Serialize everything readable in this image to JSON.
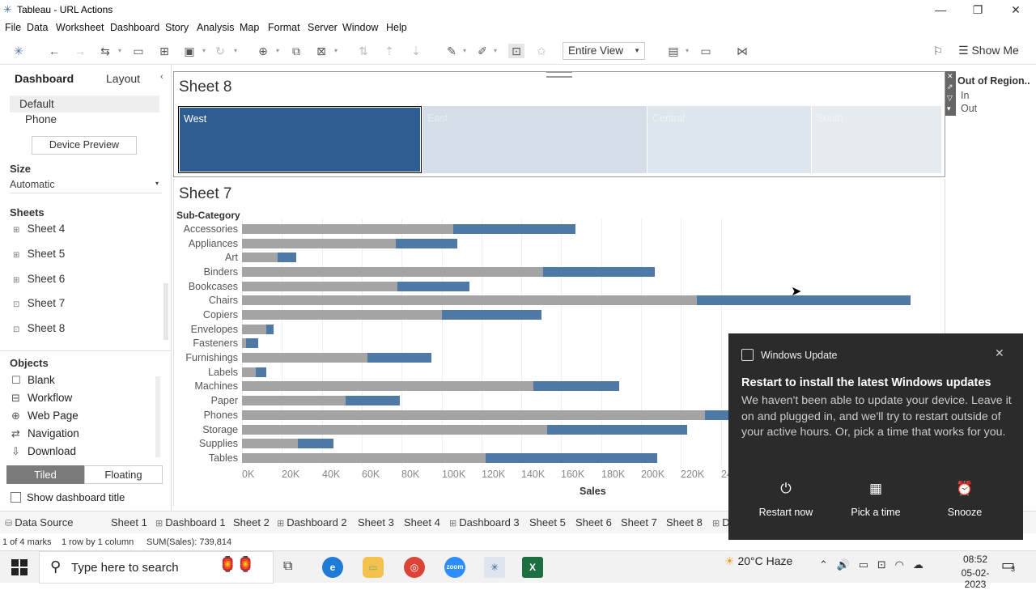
{
  "window": {
    "title": "Tableau - URL Actions",
    "minimize": "—",
    "restore": "❐",
    "close": "✕"
  },
  "menu": [
    "File",
    "Data",
    "Worksheet",
    "Dashboard",
    "Story",
    "Analysis",
    "Map",
    "Format",
    "Server",
    "Window",
    "Help"
  ],
  "toolbar": {
    "view_select": "Entire View",
    "show_me": "Show Me"
  },
  "sidebar": {
    "tabs": {
      "dashboard": "Dashboard",
      "layout": "Layout"
    },
    "device": {
      "default": "Default",
      "phone": "Phone",
      "preview_button": "Device Preview"
    },
    "size": {
      "heading": "Size",
      "value": "Automatic"
    },
    "sheets_heading": "Sheets",
    "sheets": [
      "Sheet 4",
      "Sheet 5",
      "Sheet 6",
      "Sheet 7",
      "Sheet 8"
    ],
    "objects_heading": "Objects",
    "objects": [
      {
        "label": "Blank",
        "icon": "blank-icon"
      },
      {
        "label": "Workflow",
        "icon": "workflow-icon"
      },
      {
        "label": "Web Page",
        "icon": "globe-icon"
      },
      {
        "label": "Navigation",
        "icon": "navigation-icon"
      },
      {
        "label": "Download",
        "icon": "download-icon"
      }
    ],
    "tiled": "Tiled",
    "floating": "Floating",
    "show_title": "Show dashboard title"
  },
  "sheet8": {
    "title": "Sheet 8",
    "regions": [
      {
        "name": "West",
        "color": "#2e5d93",
        "selected": true
      },
      {
        "name": "East",
        "color": "#d5dde8",
        "selected": false
      },
      {
        "name": "Central",
        "color": "#dde6ed",
        "selected": false
      },
      {
        "name": "South",
        "color": "#e6ebef",
        "selected": false
      }
    ],
    "legend": {
      "title": "Out of Region..",
      "items": [
        "In",
        "Out"
      ]
    }
  },
  "sheet7": {
    "title": "Sheet 7",
    "row_header": "Sub-Category"
  },
  "chart_data": {
    "type": "bar",
    "stacked": true,
    "orientation": "horizontal",
    "categories": [
      "Accessories",
      "Appliances",
      "Art",
      "Binders",
      "Bookcases",
      "Chairs",
      "Copiers",
      "Envelopes",
      "Fasteners",
      "Furnishings",
      "Labels",
      "Machines",
      "Paper",
      "Phones",
      "Storage",
      "Supplies",
      "Tables"
    ],
    "series": [
      {
        "name": "Out",
        "color": "#a4a4a4",
        "values": [
          106000,
          77000,
          18000,
          151000,
          78000,
          228000,
          100000,
          12000,
          2000,
          63000,
          7000,
          146000,
          52000,
          232000,
          153000,
          28000,
          122000
        ]
      },
      {
        "name": "In",
        "color": "#4e79a7",
        "values": [
          61000,
          31000,
          9000,
          56000,
          36000,
          107000,
          50000,
          4000,
          6000,
          32000,
          5000,
          43000,
          27000,
          98000,
          70000,
          18000,
          86000
        ]
      }
    ],
    "xlabel": "Sales",
    "ylabel": "Sub-Category",
    "xticks": [
      "0K",
      "20K",
      "40K",
      "60K",
      "80K",
      "100K",
      "120K",
      "140K",
      "160K",
      "180K",
      "200K",
      "220K",
      "240K"
    ],
    "xlim": [
      0,
      350000
    ],
    "grid": true,
    "legend": "Out of Region.. (In / Out)"
  },
  "tabs": [
    {
      "label": "Data Source",
      "icon": "database-icon"
    },
    {
      "label": "Sheet 1",
      "icon": ""
    },
    {
      "label": "Dashboard 1",
      "icon": "dashboard-icon"
    },
    {
      "label": "Sheet 2",
      "icon": ""
    },
    {
      "label": "Dashboard 2",
      "icon": "dashboard-icon"
    },
    {
      "label": "Sheet 3",
      "icon": ""
    },
    {
      "label": "Sheet 4",
      "icon": ""
    },
    {
      "label": "Dashboard 3",
      "icon": "dashboard-icon"
    },
    {
      "label": "Sheet 5",
      "icon": ""
    },
    {
      "label": "Sheet 6",
      "icon": ""
    },
    {
      "label": "Sheet 7",
      "icon": ""
    },
    {
      "label": "Sheet 8",
      "icon": ""
    },
    {
      "label": "D",
      "icon": "dashboard-icon"
    }
  ],
  "status": {
    "marks": "1 of 4 marks",
    "rows": "1 row by 1 column",
    "sum": "SUM(Sales): 739,814"
  },
  "taskbar": {
    "search_placeholder": "Type here to search",
    "weather": "20°C  Haze",
    "time": "08:52",
    "date": "05-02-2023",
    "notifications": "3"
  },
  "toast": {
    "app": "Windows Update",
    "heading": "Restart to install the latest Windows updates",
    "body": "We haven't been able to update your device. Leave it on and plugged in, and we'll try to restart outside of your active hours. Or, pick a time that works for you.",
    "actions": [
      {
        "label": "Restart now",
        "icon": "power-icon",
        "glyph": "⏻"
      },
      {
        "label": "Pick a time",
        "icon": "calendar-icon",
        "glyph": "▦"
      },
      {
        "label": "Snooze",
        "icon": "alarm-icon",
        "glyph": "⏰"
      }
    ]
  }
}
